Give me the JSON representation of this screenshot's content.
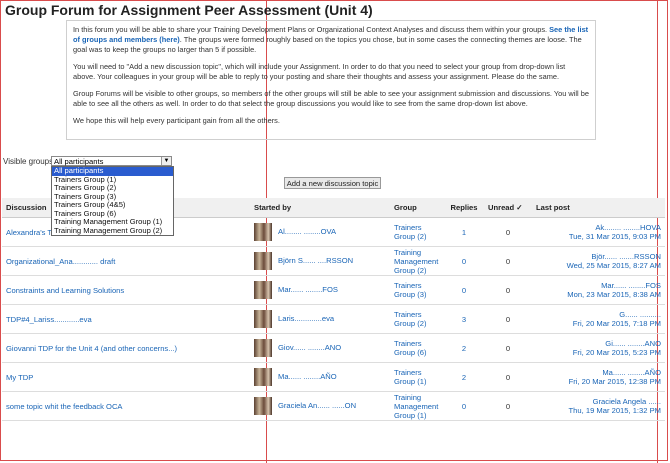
{
  "page_title": "Group Forum for Assignment Peer Assessment (Unit 4)",
  "intro": {
    "p1_before_link": "In this forum you will be able to share your Training Development Plans or Organizational Context Analyses and discuss them within your groups. ",
    "p1_link": "See the list of groups and members (here)",
    "p1_after_link": ". The groups were formed roughly based on the topics you chose, but in some cases the connecting themes are loose. The goal was to keep the groups no larger than 5 if possible.",
    "p2": "You will need to \"Add a new discussion topic\", which will include your Assignment. In order to do that you need to select your group from drop-down list above. Your colleagues in your group will be able to reply to your posting and share their thoughts and assess your assignment. Please do the same.",
    "p3": "Group Forums will be visible to other groups, so members of the other groups will still be able to see your assignment submission and discussions. You will be able to see all the others as well. In order to do that select the group discussions you would like to see from the same drop-down list above.",
    "p4": "We hope this will help every participant gain from all the others."
  },
  "visible_groups": {
    "label": "Visible groups",
    "selected": "All participants",
    "options": [
      "All participants",
      "Trainers Group (1)",
      "Trainers Group (2)",
      "Trainers Group (3)",
      "Trainers Group (4&5)",
      "Trainers Group (6)",
      "Training Management Group (1)",
      "Training Management Group (2)"
    ]
  },
  "add_button": "Add a new discussion topic",
  "table": {
    "headers": {
      "discussion": "Discussion",
      "started_by": "Started by",
      "group": "Group",
      "replies": "Replies",
      "unread": "Unread ✓",
      "last_post": "Last post"
    },
    "rows": [
      {
        "discussion": "Alexandra's T",
        "started_by": "Al........ ........OVA",
        "group": "Trainers Group (2)",
        "replies": "1",
        "unread": "0",
        "last_author": "Ak........ ........HOVA",
        "last_date": "Tue, 31 Mar 2015, 9:03 PM"
      },
      {
        "discussion": "Organizational_Ana............ draft",
        "started_by": "Björn S...... ....RSSON",
        "group": "Training Management Group (2)",
        "replies": "0",
        "unread": "0",
        "last_author": "Björ...... .......RSSON",
        "last_date": "Wed, 25 Mar 2015, 8:27 AM"
      },
      {
        "discussion": "Constraints and Learning Solutions",
        "started_by": "Mar...... ........FOS",
        "group": "Trainers Group (3)",
        "replies": "0",
        "unread": "0",
        "last_author": "Mar...... ........FOS",
        "last_date": "Mon, 23 Mar 2015, 8:38 AM"
      },
      {
        "discussion": "TDP#4_Lariss............eva",
        "started_by": "Laris.............eva",
        "group": "Trainers Group (2)",
        "replies": "3",
        "unread": "0",
        "last_author": "G...... ..........",
        "last_date": "Fri, 20 Mar 2015, 7:18 PM"
      },
      {
        "discussion": "Giovanni TDP for the Unit 4 (and other concerns...)",
        "started_by": "Giov...... ........ANO",
        "group": "Trainers Group (6)",
        "replies": "2",
        "unread": "0",
        "last_author": "Gi...... ........ANO",
        "last_date": "Fri, 20 Mar 2015, 5:23 PM"
      },
      {
        "discussion": "My TDP",
        "started_by": "Ma...... ........AÑO",
        "group": "Trainers Group (1)",
        "replies": "2",
        "unread": "0",
        "last_author": "Ma...... ........AÑO",
        "last_date": "Fri, 20 Mar 2015, 12:38 PM"
      },
      {
        "discussion": "some topic whit the feedback OCA",
        "started_by": "Graciela An...... ......ON",
        "group": "Training Management Group (1)",
        "replies": "0",
        "unread": "0",
        "last_author": "Graciela Angela ......",
        "last_date": "Thu, 19 Mar 2015, 1:32 PM"
      }
    ]
  }
}
